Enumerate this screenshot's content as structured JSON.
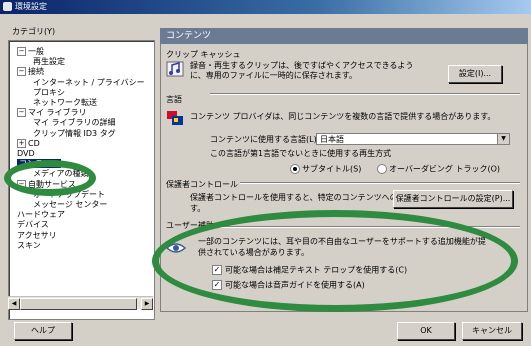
{
  "window": {
    "title": "環境設定"
  },
  "category_label": "カテゴリ(Y)",
  "tree": [
    {
      "label": "一般",
      "expander": "−"
    },
    {
      "label": "再生設定"
    },
    {
      "label": "接続",
      "expander": "−"
    },
    {
      "label": "インターネット / プライバシー"
    },
    {
      "label": "プロキシ"
    },
    {
      "label": "ネットワーク転送"
    },
    {
      "label": "マイ ライブラリ",
      "expander": "−"
    },
    {
      "label": "マイ ライブラリの詳細"
    },
    {
      "label": "クリップ情報 ID3 タグ"
    },
    {
      "label": "CD",
      "expander": "+"
    },
    {
      "label": "DVD"
    },
    {
      "label": "コンテンツ",
      "selected": true
    },
    {
      "label": "メディアの種類"
    },
    {
      "label": "自動サービス",
      "expander": "−"
    },
    {
      "label": "オートアップデート"
    },
    {
      "label": "メッセージ センター"
    },
    {
      "label": "ハードウェア"
    },
    {
      "label": "デバイス"
    },
    {
      "label": "アクセサリ"
    },
    {
      "label": "スキン"
    }
  ],
  "panel": {
    "title": "コンテンツ",
    "clip_cache": {
      "heading": "クリップ キャッシュ",
      "description_line1": "録音・再生するクリップは、後ですばやくアクセスできるよう",
      "description_line2": "に、専用のファイルに一時的に保存されます。",
      "settings_button": "設定(I)..."
    },
    "language": {
      "heading": "言語",
      "description": "コンテンツ プロバイダは、同じコンテンツを複数の言語で提供する場合があります。",
      "preferred_label": "コンテンツに使用する言語(L):",
      "preferred_value": "日本語",
      "fallback_label": "この言語が第1言語でないときに使用する再生方式",
      "option_subtitles": "サブタイトル(S)",
      "option_overdub": "オーバーダビング トラック(O)",
      "selected_option": "subtitles"
    },
    "parental": {
      "heading": "保護者コントロール",
      "line1": "保護者コントロールを使用すると、特定のコンテンツへのアクセスを制限できま",
      "line2": "す。",
      "button": "保護者コントロールの設定(P)..."
    },
    "accessibility": {
      "heading": "ユーザー補助",
      "description_line1": "一部のコンテンツには、耳や目の不自由なユーザーをサポートする追加機能が提",
      "description_line2": "供されている場合があります。",
      "checkbox_captions": {
        "label": "可能な場合は補足テキスト テロップを使用する(C)",
        "checked": true
      },
      "checkbox_audio": {
        "label": "可能な場合は音声ガイドを使用する(A)",
        "checked": true
      }
    }
  },
  "buttons": {
    "help": "ヘルプ",
    "ok": "OK",
    "cancel": "キャンセル"
  },
  "annotation_color": "#2e8b3f"
}
